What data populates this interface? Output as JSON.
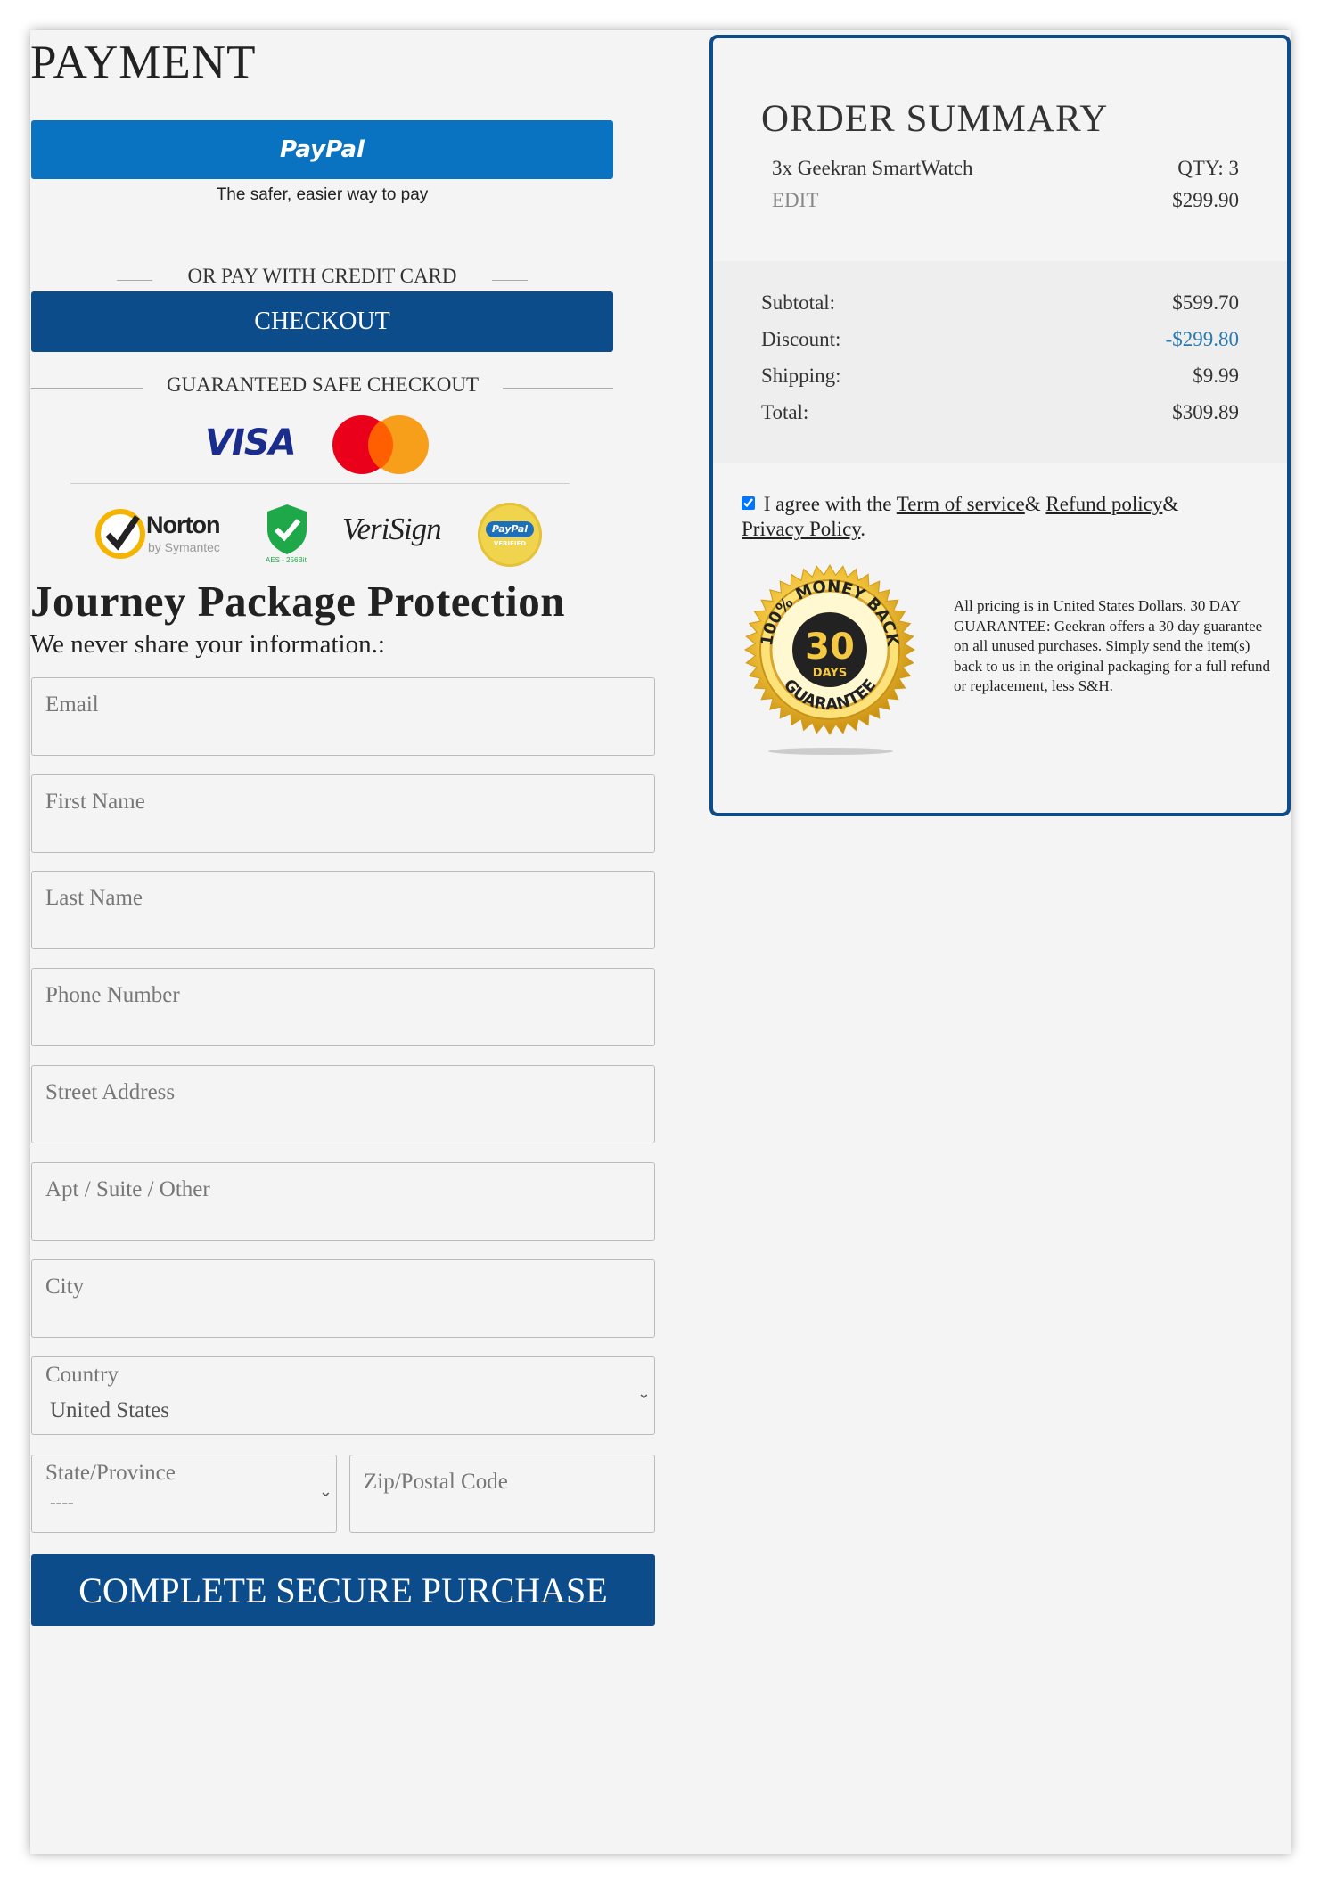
{
  "payment": {
    "title": "PAYMENT",
    "paypal_label": "PayPal",
    "paypal_tagline": "The safer, easier way to pay",
    "or_pay_label": "OR PAY WITH CREDIT CARD",
    "checkout_label": "CHECKOUT",
    "guaranteed_label": "GUARANTEED SAFE CHECKOUT",
    "card_logos": {
      "visa": "VISA"
    },
    "trust_badges": {
      "norton": "Norton",
      "norton_sub": "by Symantec",
      "aes": "AES - 256Bit",
      "verisign": "VeriSign",
      "paypal_verified_top": "PayPal",
      "paypal_verified_bottom": "VERIFIED"
    }
  },
  "form": {
    "heading": "Journey Package Protection",
    "subheading": "We never share your information.:",
    "email_placeholder": "Email",
    "first_name_placeholder": "First Name",
    "last_name_placeholder": "Last Name",
    "phone_placeholder": "Phone Number",
    "street_placeholder": "Street Address",
    "apt_placeholder": "Apt / Suite / Other",
    "city_placeholder": "City",
    "country_label": "Country",
    "country_value": "United States",
    "state_label": "State/Province",
    "state_value": "----",
    "zip_placeholder": "Zip/Postal Code",
    "submit_label": "COMPLETE SECURE PURCHASE"
  },
  "order_summary": {
    "title": "ORDER SUMMARY",
    "item_name": "3x Geekran SmartWatch",
    "item_qty": "QTY: 3",
    "edit_label": "EDIT",
    "item_price": "$299.90",
    "subtotal_label": "Subtotal:",
    "subtotal_value": "$599.70",
    "discount_label": "Discount:",
    "discount_value": "-$299.80",
    "shipping_label": "Shipping:",
    "shipping_value": "$9.99",
    "total_label": "Total:",
    "total_value": "$309.89",
    "agree_prefix": "I agree with the",
    "terms_link": "Term of service",
    "refund_link": "Refund policy",
    "privacy_link": "Privacy Policy",
    "agree_checked": true,
    "badge": {
      "top_text": "100% MONEY BACK",
      "number": "30",
      "days": "DAYS",
      "bottom_text": "GUARANTEE"
    },
    "fine_print": "All pricing is in United States Dollars. 30 DAY GUARANTEE: Geekran offers a 30 day guarantee on all unused purchases. Simply send the item(s) back to us in the original packaging for a full refund or replacement, less S&H."
  },
  "colors": {
    "paypal_blue": "#0a73c1",
    "navy": "#0d4c8b",
    "discount_blue": "#2a7ab0",
    "page_bg": "#f4f4f4"
  }
}
